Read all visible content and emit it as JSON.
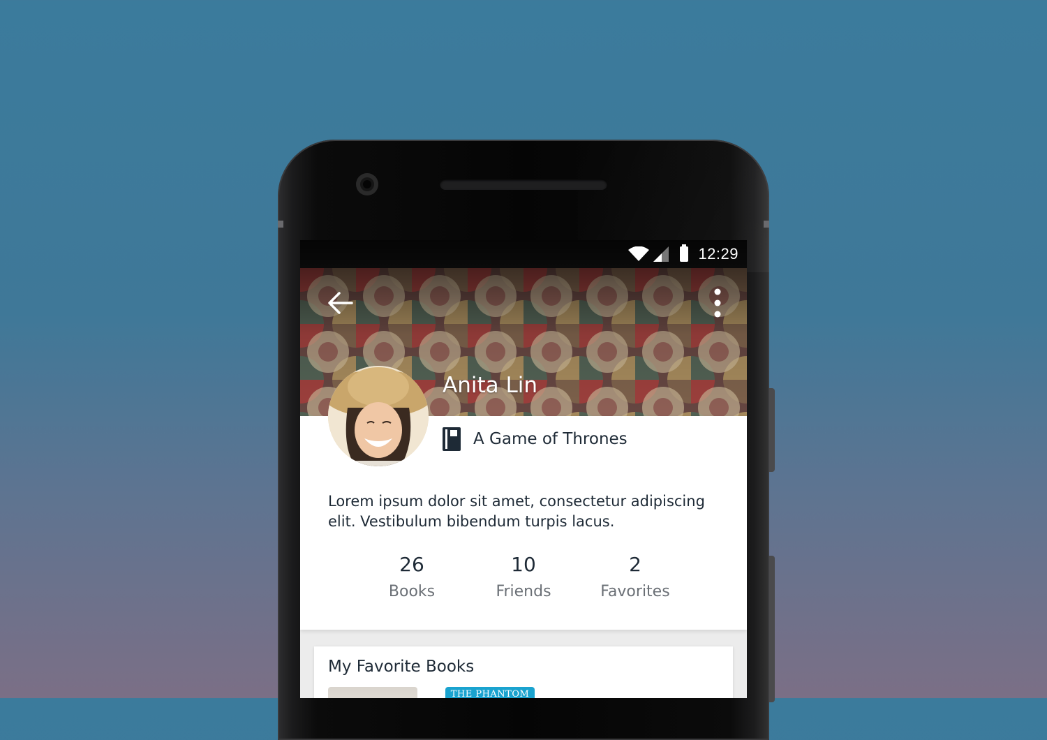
{
  "status_bar": {
    "time": "12:29"
  },
  "profile": {
    "name": "Anita Lin",
    "currently_reading": "A Game of Thrones",
    "bio": "Lorem ipsum dolor sit amet, consectetur adipiscing elit. Vestibulum bibendum turpis lacus."
  },
  "stats": [
    {
      "value": "26",
      "label": "Books"
    },
    {
      "value": "10",
      "label": "Friends"
    },
    {
      "value": "2",
      "label": "Favorites"
    }
  ],
  "favorites": {
    "title": "My Favorite Books",
    "books": [
      {
        "title": ""
      },
      {
        "title": "THE PHANTOM"
      }
    ]
  },
  "colors": {
    "accent": "#1aa3cf",
    "text_dark": "#1e2a36",
    "text_muted": "#6a6f75"
  },
  "icons": {
    "back": "arrow-left-icon",
    "more": "more-vertical-icon",
    "book": "book-icon",
    "wifi": "wifi-icon",
    "signal": "signal-icon",
    "battery": "battery-icon"
  }
}
